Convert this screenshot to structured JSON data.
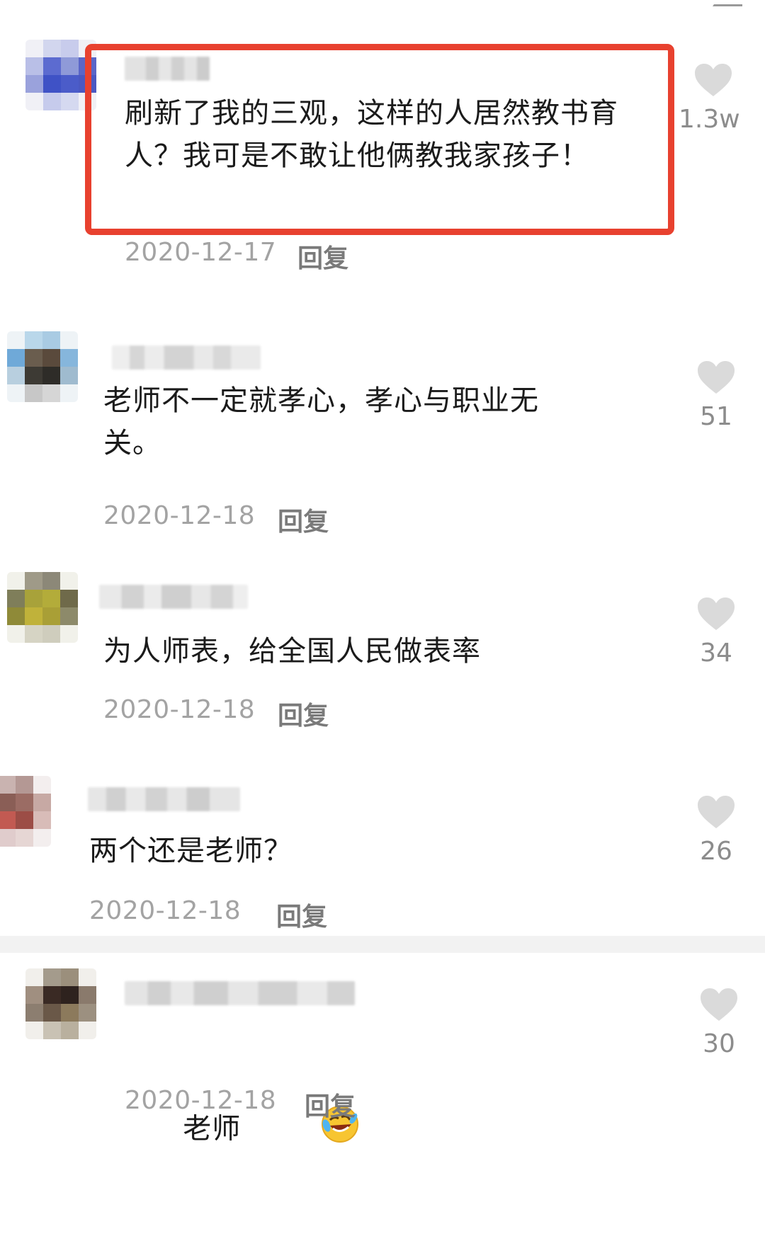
{
  "comments": [
    {
      "content": "刷新了我的三观，这样的人居然教书育人？我可是不敢让他俩教我家孩子！",
      "date": "2020-12-17",
      "reply_label": "回复",
      "likes": "1.3w"
    },
    {
      "content": "老师不一定就孝心，孝心与职业无关。",
      "date": "2020-12-18",
      "reply_label": "回复",
      "likes": "51"
    },
    {
      "content": "为人师表，给全国人民做表率",
      "date": "2020-12-18",
      "reply_label": "回复",
      "likes": "34"
    },
    {
      "content": "两个还是老师？",
      "date": "2020-12-18",
      "reply_label": "回复",
      "likes": "26"
    },
    {
      "content": "老师",
      "emoji": "rofl-emoji",
      "date": "2020-12-18",
      "reply_label": "回复",
      "likes": "30"
    }
  ],
  "colors": {
    "highlight_border": "#e8412f",
    "like_icon": "#dadada",
    "meta_text": "#a3a3a3",
    "reply_text": "#7a7a7a"
  },
  "icons": {
    "like": "heart-icon"
  }
}
